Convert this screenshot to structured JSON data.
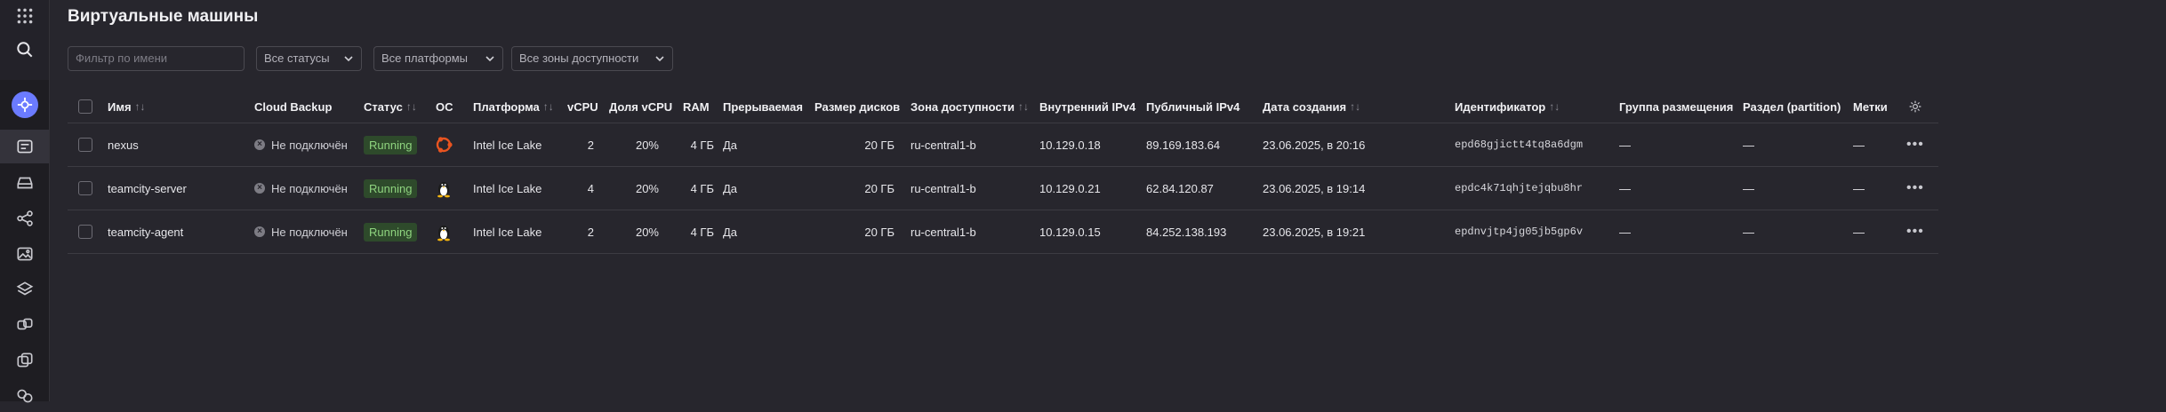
{
  "page": {
    "title": "Виртуальные машины"
  },
  "filters": {
    "name_placeholder": "Фильтр по имени",
    "status_label": "Все статусы",
    "platform_label": "Все платформы",
    "zone_label": "Все зоны доступности"
  },
  "table": {
    "headers": {
      "name": "Имя",
      "backup": "Cloud Backup",
      "status": "Статус",
      "os": "ОС",
      "platform": "Платформа",
      "vcpu": "vCPU",
      "share": "Доля vCPU",
      "ram": "RAM",
      "preemptible": "Прерываемая",
      "disk": "Размер дисков",
      "zone": "Зона доступности",
      "ipv4_int": "Внутренний IPv4",
      "ipv4_pub": "Публичный IPv4",
      "created": "Дата создания",
      "id": "Идентификатор",
      "group": "Группа размещения",
      "partition": "Раздел (partition)",
      "labels": "Метки"
    },
    "sort_glyph": "↑↓",
    "rows": [
      {
        "name": "nexus",
        "backup": "Не подключён",
        "status": "Running",
        "os": "ubuntu-icon",
        "platform": "Intel Ice Lake",
        "vcpu": "2",
        "share": "20%",
        "ram": "4 ГБ",
        "preemptible": "Да",
        "disk": "20 ГБ",
        "zone": "ru-central1-b",
        "ipv4_int": "10.129.0.18",
        "ipv4_pub": "89.169.183.64",
        "created": "23.06.2025, в 20:16",
        "id": "epd68gjictt4tq8a6dgm",
        "group": "—",
        "partition": "—",
        "labels": "—"
      },
      {
        "name": "teamcity-server",
        "backup": "Не подключён",
        "status": "Running",
        "os": "linux-icon",
        "platform": "Intel Ice Lake",
        "vcpu": "4",
        "share": "20%",
        "ram": "4 ГБ",
        "preemptible": "Да",
        "disk": "20 ГБ",
        "zone": "ru-central1-b",
        "ipv4_int": "10.129.0.21",
        "ipv4_pub": "62.84.120.87",
        "created": "23.06.2025, в 19:14",
        "id": "epdc4k71qhjtejqbu8hr",
        "group": "—",
        "partition": "—",
        "labels": "—"
      },
      {
        "name": "teamcity-agent",
        "backup": "Не подключён",
        "status": "Running",
        "os": "linux-icon",
        "platform": "Intel Ice Lake",
        "vcpu": "2",
        "share": "20%",
        "ram": "4 ГБ",
        "preemptible": "Да",
        "disk": "20 ГБ",
        "zone": "ru-central1-b",
        "ipv4_int": "10.129.0.15",
        "ipv4_pub": "84.252.138.193",
        "created": "23.06.2025, в 19:21",
        "id": "epdnvjtp4jg05jb5gp6v",
        "group": "—",
        "partition": "—",
        "labels": "—"
      }
    ]
  },
  "colors": {
    "background": "#27262d",
    "rail": "#1e1d22",
    "status_running_bg": "#2e4a2b",
    "status_running_fg": "#8fd47f",
    "brand": "#6b7bff",
    "ubuntu": "#e95420"
  }
}
